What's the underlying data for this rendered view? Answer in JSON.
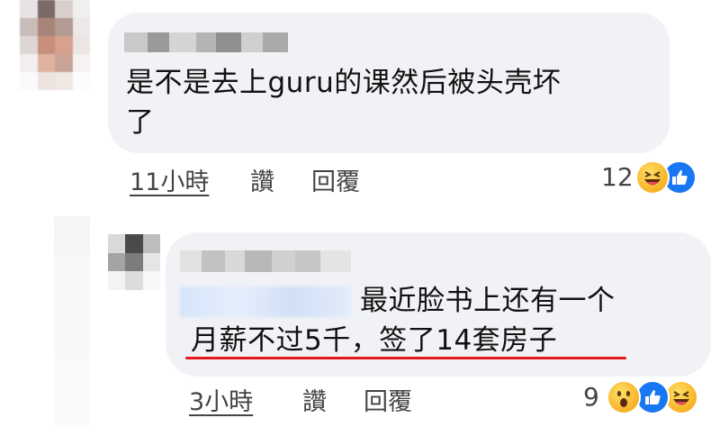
{
  "comments": [
    {
      "text_line1": "是不是去上guru的课然后被头壳坏",
      "text_line2": "了",
      "time": "11小時",
      "like_label": "讚",
      "reply_label": "回覆",
      "reaction_count": "12",
      "reactions": [
        "laugh-react-icon",
        "like-react-icon"
      ]
    },
    {
      "text_line1": "最近脸书上还有一个",
      "text_line2": "月薪不过5千，签了14套房子",
      "time": "3小時",
      "like_label": "讚",
      "reply_label": "回覆",
      "reaction_count": "9",
      "reactions": [
        "wow-react-icon",
        "like-react-icon",
        "laugh-react-icon"
      ]
    }
  ],
  "colors": {
    "bubble": "#f0f2f5",
    "underline": "#e8171e",
    "like_blue": "#1877f2",
    "meta_text": "#444444"
  }
}
